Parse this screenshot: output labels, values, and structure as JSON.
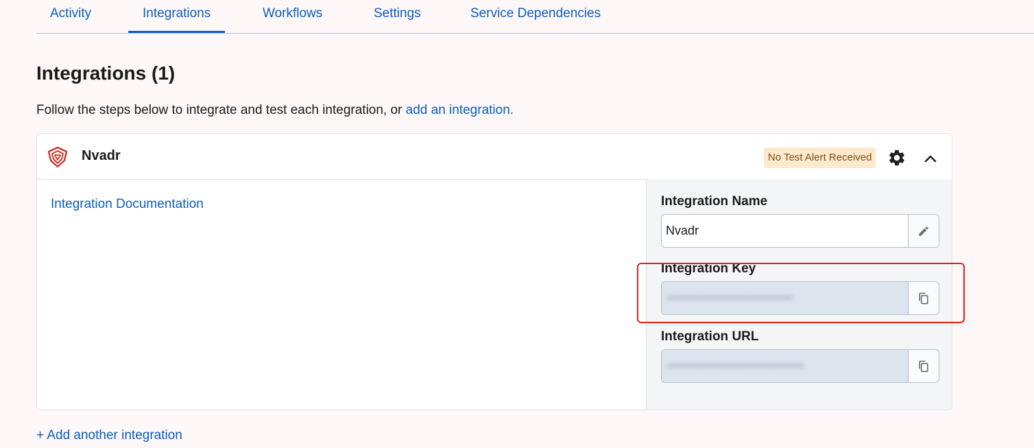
{
  "tabs": [
    {
      "label": "Activity"
    },
    {
      "label": "Integrations"
    },
    {
      "label": "Workflows"
    },
    {
      "label": "Settings"
    },
    {
      "label": "Service Dependencies"
    }
  ],
  "page": {
    "title": "Integrations (1)",
    "intro_text": "Follow the steps below to integrate and test each integration, or ",
    "intro_link": "add an integration."
  },
  "integration": {
    "name": "Nvadr",
    "status_badge": "No Test Alert Received",
    "doc_link": "Integration Documentation",
    "fields": {
      "name_label": "Integration Name",
      "name_value": "Nvadr",
      "key_label": "Integration Key",
      "url_label": "Integration URL"
    },
    "icons": [
      "shield-logo-icon",
      "gear-icon",
      "chevron-up-icon",
      "pencil-icon",
      "copy-icon"
    ]
  },
  "footer": {
    "add_another": "+ Add another integration"
  },
  "colors": {
    "link": "#0b5cbf",
    "badge_bg": "#fde9cd",
    "highlight": "#e02020",
    "page_bg": "#fdf8f7"
  }
}
